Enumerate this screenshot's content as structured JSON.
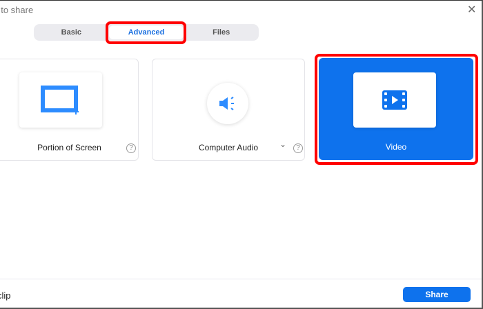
{
  "window": {
    "title": "t to share",
    "close_icon": "close-icon"
  },
  "tabs": [
    {
      "label": "Basic"
    },
    {
      "label": "Advanced",
      "active": true
    },
    {
      "label": "Files"
    }
  ],
  "options": [
    {
      "label": "Portion of Screen",
      "icon": "portion-screen-icon",
      "help": "?"
    },
    {
      "label": "Computer Audio",
      "icon": "speaker-icon",
      "dropdown": "⌄",
      "help": "?"
    },
    {
      "label": "Video",
      "icon": "video-icon",
      "selected": true
    }
  ],
  "footer": {
    "clip_label": "clip",
    "share_label": "Share"
  },
  "colors": {
    "accent": "#0e72ed",
    "highlight": "#ff0000"
  }
}
